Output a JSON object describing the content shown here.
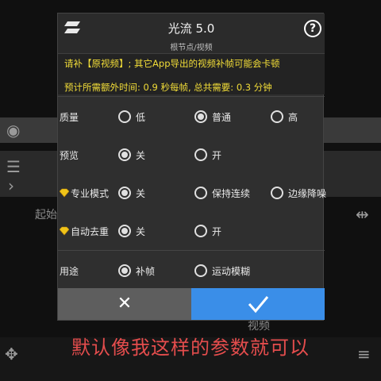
{
  "dialog": {
    "title": "光流 5.0",
    "subtitle": "根节点/视频",
    "notice_line1": "请补【原视频】; 其它App导出的视频补帧可能会卡顿",
    "notice_line2": "预计所需额外时间: 0.9 秒每帧, 总共需要: 0.3 分钟",
    "rows": [
      {
        "label": "质量",
        "options": [
          "低",
          "普通",
          "高"
        ],
        "selected": 1
      },
      {
        "label": "预览",
        "options": [
          "关",
          "开"
        ],
        "selected": 0
      },
      {
        "label": "专业模式",
        "options": [
          "关",
          "保持连续",
          "边缘降噪"
        ],
        "selected": 0,
        "premium": true
      },
      {
        "label": "自动去重",
        "options": [
          "关",
          "开"
        ],
        "selected": 0,
        "premium": true
      },
      {
        "label": "用途",
        "options": [
          "补帧",
          "运动模糊"
        ],
        "selected": 0
      }
    ],
    "cancel_label": "✕"
  },
  "background": {
    "label_start": "起始",
    "label_video": "视频"
  },
  "caption": "默认像我这样的参数就可以",
  "colors": {
    "accent": "#3a8ee8",
    "notice": "#f2dd38",
    "caption": "#e54d4d"
  }
}
